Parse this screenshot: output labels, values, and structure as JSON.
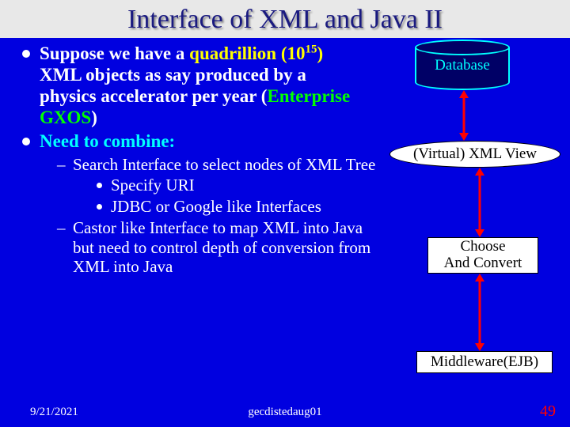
{
  "title": "Interface of XML and Java II",
  "bullets": {
    "item1": {
      "pre": "Suppose we have a ",
      "quadrillion": "quadrillion (10",
      "exp": "15",
      "after_exp": ")",
      "mid": " XML objects as say produced by a physics accelerator per year (",
      "enterprise": "Enterprise GXOS",
      "close": ")"
    },
    "item2": {
      "label": "Need to combine:"
    }
  },
  "sub": {
    "d1a": "Search Interface to select nodes of XML Tree",
    "b1": "Specify URI",
    "b2": "JDBC or Google like Interfaces",
    "d2": "Castor like Interface to map XML into Java but need to control depth of conversion from XML into Java"
  },
  "diagram": {
    "database": "Database",
    "view": "(Virtual) XML View",
    "choose1": "Choose",
    "choose2": "And Convert",
    "middleware": "Middleware(EJB)"
  },
  "footer": {
    "date": "9/21/2021",
    "mid": "gecdistedaug01",
    "num": "49"
  }
}
